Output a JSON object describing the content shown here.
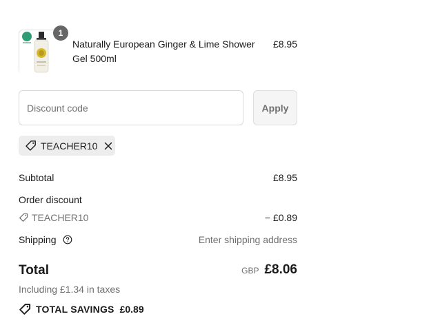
{
  "line_item": {
    "quantity": "1",
    "name": "Naturally European Ginger & Lime Shower Gel 500ml",
    "price": "£8.95"
  },
  "discount": {
    "placeholder": "Discount code",
    "apply_label": "Apply",
    "applied_code": "TEACHER10"
  },
  "summary": {
    "subtotal_label": "Subtotal",
    "subtotal_value": "£8.95",
    "order_discount_label": "Order discount",
    "discount_code": "TEACHER10",
    "discount_value": "− £0.89",
    "shipping_label": "Shipping",
    "shipping_value": "Enter shipping address",
    "total_label": "Total",
    "currency": "GBP",
    "total_value": "£8.06",
    "taxes_note": "Including £1.34 in taxes",
    "savings_label": "TOTAL SAVINGS",
    "savings_value": "£0.89"
  },
  "icons": {
    "tag": "tag-icon",
    "close": "close-icon",
    "help": "help-circle-icon",
    "savings": "tag-icon"
  }
}
